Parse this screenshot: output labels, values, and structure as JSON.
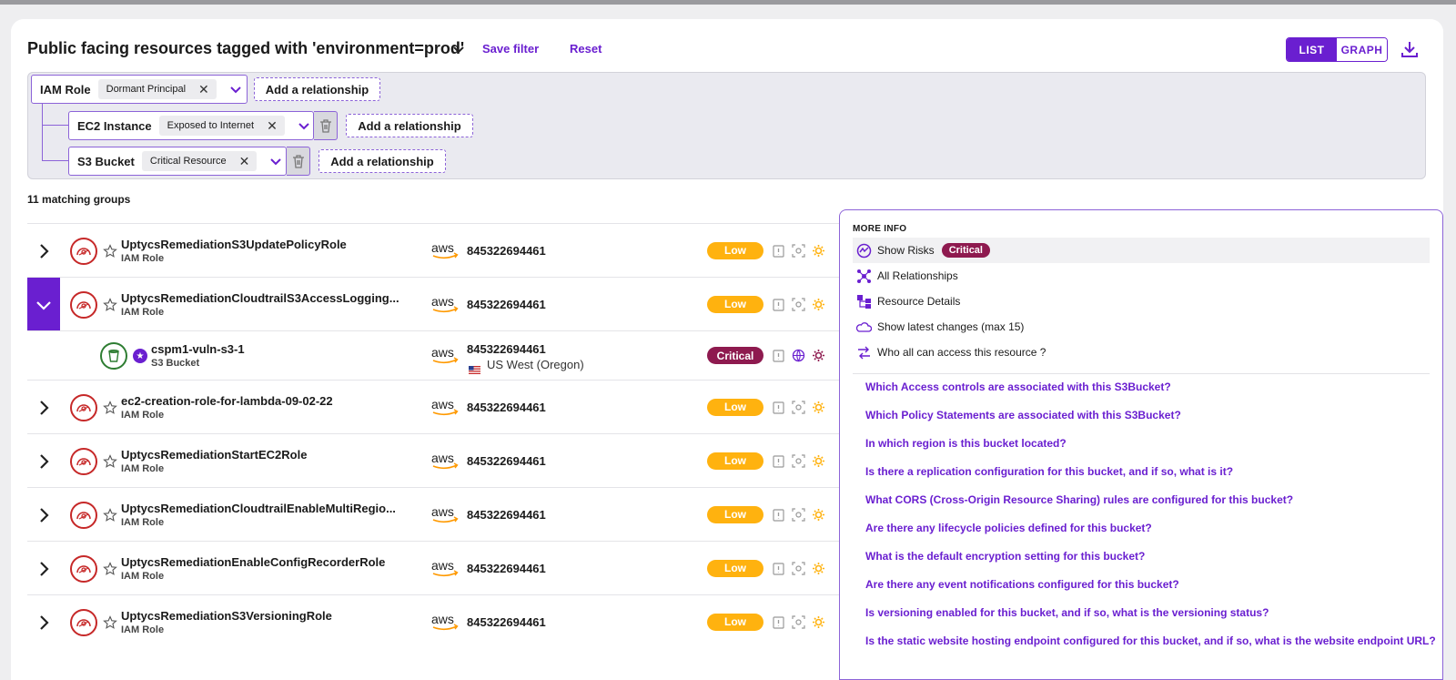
{
  "header": {
    "title": "Public facing resources tagged with 'environment=prod'",
    "save_filter": "Save filter",
    "reset": "Reset",
    "view_list": "LIST",
    "view_graph": "GRAPH"
  },
  "filter": {
    "root": {
      "label": "IAM Role",
      "chip": "Dormant Principal"
    },
    "children": [
      {
        "label": "EC2 Instance",
        "chip": "Exposed to Internet"
      },
      {
        "label": "S3 Bucket",
        "chip": "Critical Resource"
      }
    ],
    "add_relationship": "Add a relationship"
  },
  "results": {
    "count_label": "11 matching groups",
    "rows": [
      {
        "name": "UptycsRemediationS3UpdatePolicyRole",
        "type": "IAM Role",
        "account": "845322694461",
        "severity": "Low"
      },
      {
        "name": "UptycsRemediationCloudtrailS3AccessLogging...",
        "type": "IAM Role",
        "account": "845322694461",
        "severity": "Low"
      },
      {
        "name": "cspm1-vuln-s3-1",
        "type": "S3 Bucket",
        "account": "845322694461",
        "region": "US West (Oregon)",
        "severity": "Critical"
      },
      {
        "name": "ec2-creation-role-for-lambda-09-02-22",
        "type": "IAM Role",
        "account": "845322694461",
        "severity": "Low"
      },
      {
        "name": "UptycsRemediationStartEC2Role",
        "type": "IAM Role",
        "account": "845322694461",
        "severity": "Low"
      },
      {
        "name": "UptycsRemediationCloudtrailEnableMultiRegio...",
        "type": "IAM Role",
        "account": "845322694461",
        "severity": "Low"
      },
      {
        "name": "UptycsRemediationEnableConfigRecorderRole",
        "type": "IAM Role",
        "account": "845322694461",
        "severity": "Low"
      },
      {
        "name": "UptycsRemediationS3VersioningRole",
        "type": "IAM Role",
        "account": "845322694461",
        "severity": "Low"
      }
    ]
  },
  "panel": {
    "heading": "MORE INFO",
    "items": [
      {
        "label": "Show Risks",
        "badge": "Critical"
      },
      {
        "label": "All Relationships"
      },
      {
        "label": "Resource Details"
      },
      {
        "label": "Show latest changes (max 15)"
      },
      {
        "label": "Who all can access this resource ?"
      }
    ],
    "questions": [
      "Which Access controls are associated with this S3Bucket?",
      "Which Policy Statements are associated with this S3Bucket?",
      "In which region is this bucket located?",
      "Is there a replication configuration for this bucket, and if so, what is it?",
      "What CORS (Cross-Origin Resource Sharing) rules are configured for this bucket?",
      "Are there any lifecycle policies defined for this bucket?",
      "What is the default encryption setting for this bucket?",
      "Are there any event notifications configured for this bucket?",
      "Is versioning enabled for this bucket, and if so, what is the versioning status?",
      "Is the static website hosting endpoint configured for this bucket, and if so, what is the website endpoint URL?"
    ]
  },
  "colors": {
    "accent": "#6a1fd0",
    "low": "#ffb20f",
    "critical": "#8e1a4f"
  }
}
